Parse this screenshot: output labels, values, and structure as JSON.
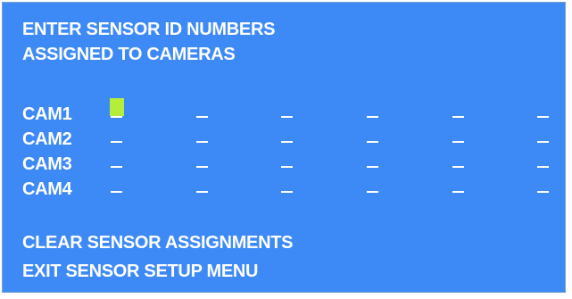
{
  "header": {
    "line1": "ENTER SENSOR ID NUMBERS",
    "line2": "ASSIGNED TO CAMERAS"
  },
  "cameras": [
    {
      "label": "CAM1",
      "slots": [
        "_",
        "_",
        "_",
        "_",
        "_",
        "_"
      ],
      "cursor_slot": 0
    },
    {
      "label": "CAM2",
      "slots": [
        "_",
        "_",
        "_",
        "_",
        "_",
        "_"
      ]
    },
    {
      "label": "CAM3",
      "slots": [
        "_",
        "_",
        "_",
        "_",
        "_",
        "_"
      ]
    },
    {
      "label": "CAM4",
      "slots": [
        "_",
        "_",
        "_",
        "_",
        "_",
        "_"
      ]
    }
  ],
  "menu": {
    "clear_label": "CLEAR SENSOR ASSIGNMENTS",
    "exit_label": "EXIT SENSOR SETUP MENU"
  },
  "colors": {
    "background": "#3d8af7",
    "text": "#ffffff",
    "cursor": "#b5ee3a"
  }
}
